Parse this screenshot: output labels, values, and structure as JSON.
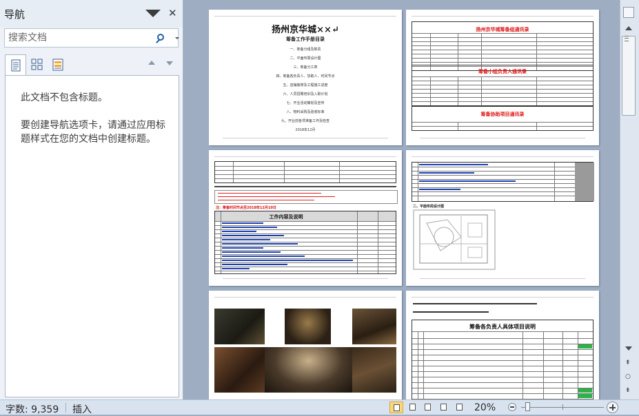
{
  "nav": {
    "title": "导航",
    "search_placeholder": "搜索文档",
    "message_line1": "此文档不包含标题。",
    "message_line2": "要创建导航选项卡，请通过应用标题样式在您的文档中创建标题。"
  },
  "pages": {
    "p1": {
      "title": "扬州京华城××↵",
      "subtitle": "筹备工作手册目录",
      "toc": [
        "一、筹备分组及职责",
        "二、平面布局设计图",
        "三、筹备分工表",
        "四、筹备各负责人、协助人、时间节点",
        "五、店铺装修及工程施工进度",
        "六、人员招聘培训及入职计划",
        "七、开业活动策划及宣传",
        "八、物料采购及验收标准",
        "九、开业前各项准备工作及检查"
      ],
      "date": "2018年12月"
    },
    "p2": {
      "red1": "扬州京华城筹备组通讯录",
      "red2": "筹备小组负责人通讯录",
      "red3": "筹备协助项目通讯录"
    },
    "p3": {
      "red1": "注：筹备时间节点至2018年12月10日",
      "table_header": "工作内容及说明"
    },
    "p4": {
      "heading": "二、平面布局设计图"
    },
    "p6": {
      "heading": "筹备各负责人具体项目说明"
    }
  },
  "status": {
    "word_count": "字数: 9,359",
    "insert_mode": "插入",
    "zoom": "20%"
  }
}
